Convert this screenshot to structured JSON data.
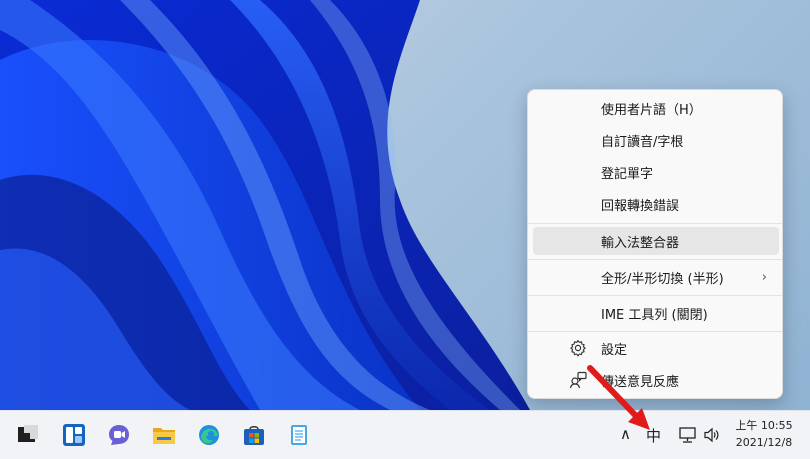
{
  "context_menu": {
    "items": [
      {
        "label": "使用者片語（H）"
      },
      {
        "label": "自訂讀音/字根"
      },
      {
        "label": "登記單字"
      },
      {
        "label": "回報轉換錯誤"
      },
      {
        "label": "輸入法整合器",
        "highlighted": true
      },
      {
        "label": "全形/半形切換 (半形)",
        "has_submenu": true
      },
      {
        "label": "IME 工具列 (關閉)"
      },
      {
        "label": "設定",
        "icon": "gear-icon"
      },
      {
        "label": "傳送意見反應",
        "icon": "feedback-icon"
      }
    ],
    "submenu_chevron": "›"
  },
  "taskbar": {
    "pinned": [
      {
        "name": "start-button",
        "icon": "windows-logo-icon"
      },
      {
        "name": "widgets-button",
        "icon": "widgets-icon"
      },
      {
        "name": "teams-chat-button",
        "icon": "chat-icon"
      },
      {
        "name": "file-explorer-button",
        "icon": "folder-icon"
      },
      {
        "name": "edge-button",
        "icon": "edge-icon"
      },
      {
        "name": "store-button",
        "icon": "store-icon"
      },
      {
        "name": "notepad-button",
        "icon": "notepad-icon"
      }
    ],
    "tray": {
      "overflow_chevron": "∧",
      "ime_indicator": "中"
    },
    "clock": {
      "time": "上午 10:55",
      "date": "2021/12/8"
    }
  },
  "colors": {
    "annotation_arrow": "#e01b1b",
    "menu_highlight": "#e6e6e6"
  }
}
